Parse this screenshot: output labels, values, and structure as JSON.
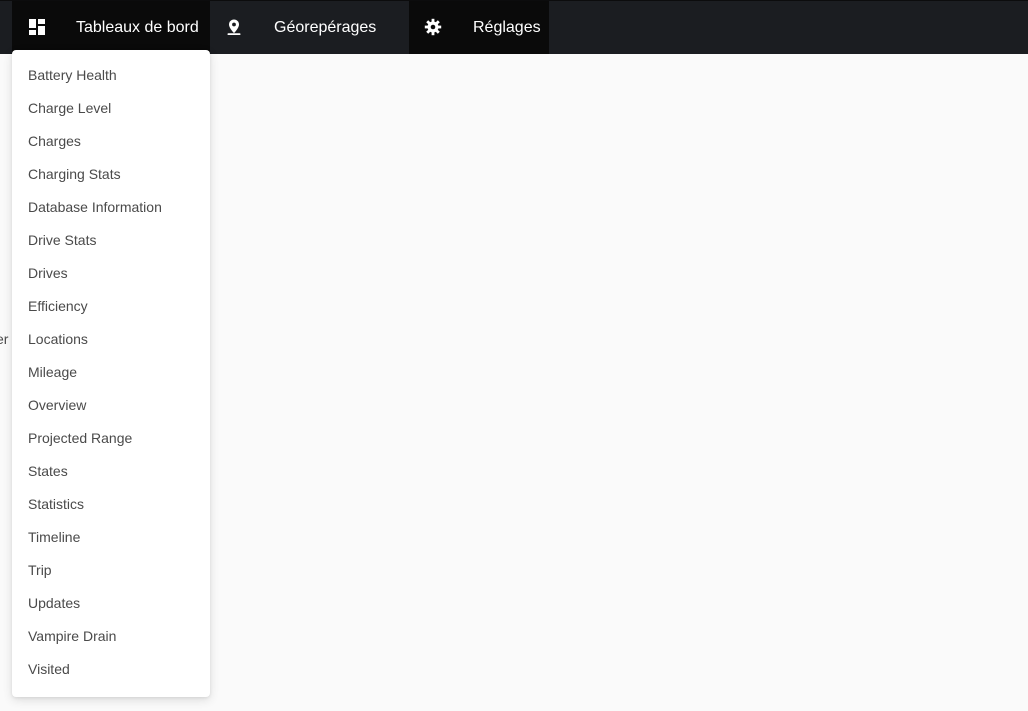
{
  "navbar": {
    "items": [
      {
        "label": "Tableaux de bord",
        "icon": "dashboard-icon"
      },
      {
        "label": "Géorepérages",
        "icon": "map-pin-icon"
      },
      {
        "label": "Réglages",
        "icon": "gear-icon"
      }
    ]
  },
  "dropdown": {
    "items": [
      "Battery Health",
      "Charge Level",
      "Charges",
      "Charging Stats",
      "Database Information",
      "Drive Stats",
      "Drives",
      "Efficiency",
      "Locations",
      "Mileage",
      "Overview",
      "Projected Range",
      "States",
      "Statistics",
      "Timeline",
      "Trip",
      "Updates",
      "Vampire Drain",
      "Visited"
    ]
  },
  "background": {
    "clipped_text": "er"
  },
  "colors": {
    "navbar": "#1b1d21",
    "active_nav": "#0a0a0a",
    "page_background": "#fafafa",
    "dropdown_background": "#ffffff",
    "menu_text": "#4a4a4a"
  }
}
